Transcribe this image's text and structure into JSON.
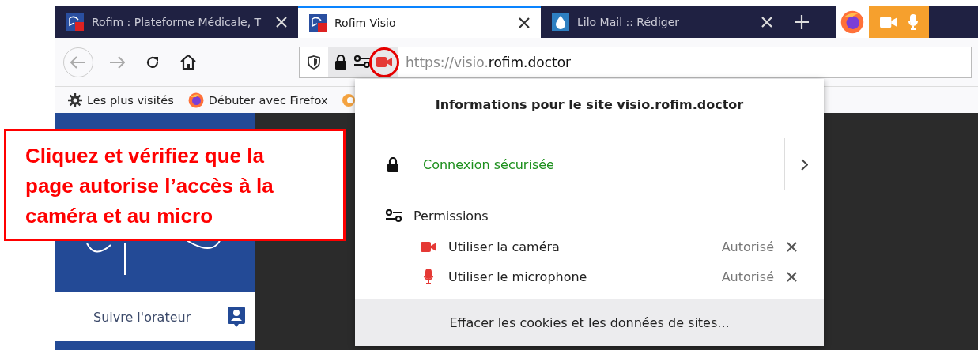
{
  "tabs": [
    {
      "title": "Rofim : Plateforme Médicale, T",
      "selected": false,
      "kind": "rofim"
    },
    {
      "title": "Rofim Visio",
      "selected": true,
      "kind": "rofim"
    },
    {
      "title": "Lilo Mail :: Rédiger",
      "selected": false,
      "kind": "mail"
    }
  ],
  "sharing_indicator": {
    "camera": true,
    "microphone": true
  },
  "address_bar": {
    "url_prefix": "https://visio.",
    "url_domain": "rofim.doctor",
    "camera_active": true
  },
  "bookmarks": [
    {
      "label": "Les plus visités",
      "kind": "gear"
    },
    {
      "label": "Débuter avec Firefox",
      "kind": "firefox"
    }
  ],
  "sidebar": {
    "follow_speaker": "Suivre l'orateur"
  },
  "site_panel": {
    "title": "Informations pour le site visio.rofim.doctor",
    "connection": "Connexion sécurisée",
    "permissions_heading": "Permissions",
    "permissions": [
      {
        "kind": "camera",
        "label": "Utiliser la caméra",
        "status": "Autorisé"
      },
      {
        "kind": "microphone",
        "label": "Utiliser le microphone",
        "status": "Autorisé"
      }
    ],
    "footer_button": "Effacer les cookies et les données de sites..."
  },
  "callout": {
    "text": "Cliquez et vérifiez que la page autorise l’accès à la caméra et au micro"
  }
}
